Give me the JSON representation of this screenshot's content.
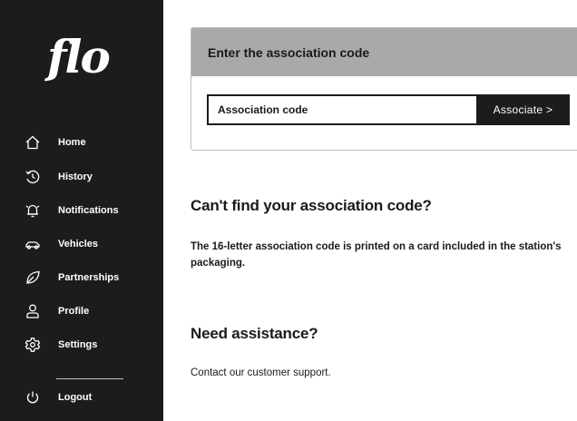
{
  "brand": {
    "logo_text": "flo"
  },
  "sidebar": {
    "items": [
      {
        "label": "Home",
        "icon": "home-icon"
      },
      {
        "label": "History",
        "icon": "history-icon"
      },
      {
        "label": "Notifications",
        "icon": "bell-icon"
      },
      {
        "label": "Vehicles",
        "icon": "car-icon"
      },
      {
        "label": "Partnerships",
        "icon": "leaf-icon"
      },
      {
        "label": "Profile",
        "icon": "user-icon"
      },
      {
        "label": "Settings",
        "icon": "gear-icon"
      }
    ],
    "logout": {
      "label": "Logout",
      "icon": "power-icon"
    }
  },
  "association": {
    "title": "Enter the association code",
    "input_placeholder": "Association code",
    "input_value": "",
    "button_label": "Associate >"
  },
  "help": {
    "heading": "Can't find your association code?",
    "text": "The 16-letter association code is printed on a card included in the station's packaging."
  },
  "assistance": {
    "heading": "Need assistance?",
    "text": "Contact our customer support."
  },
  "colors": {
    "sidebar_bg": "#1c1c1c",
    "card_header_bg": "#a9a9a9",
    "button_bg": "#1c1c1c"
  }
}
